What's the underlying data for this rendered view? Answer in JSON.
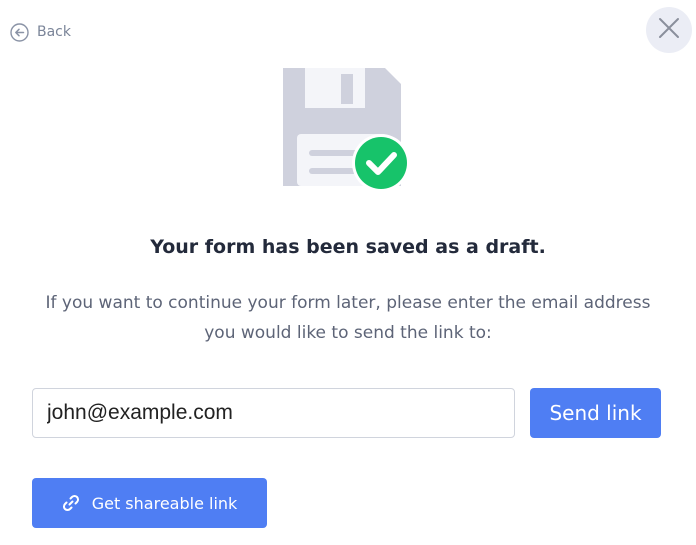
{
  "nav": {
    "back_label": "Back"
  },
  "icons": {
    "back": "arrow-left-circle-icon",
    "close": "close-icon",
    "illustration": "floppy-disk-icon",
    "check": "check-circle-icon",
    "link": "link-icon"
  },
  "content": {
    "title": "Your form has been saved as a draft.",
    "description": "If you want to continue your form later, please enter the email address you would like to send the link to:"
  },
  "email": {
    "value": "john@example.com",
    "placeholder": ""
  },
  "buttons": {
    "send_label": "Send link",
    "share_label": "Get shareable link"
  },
  "colors": {
    "accent": "#4f7ef3",
    "success": "#17c36a",
    "illustration_gray": "#cfd1dd",
    "close_bg": "#ebedf5",
    "title_text": "#232a3b",
    "body_text": "#5d6477"
  }
}
